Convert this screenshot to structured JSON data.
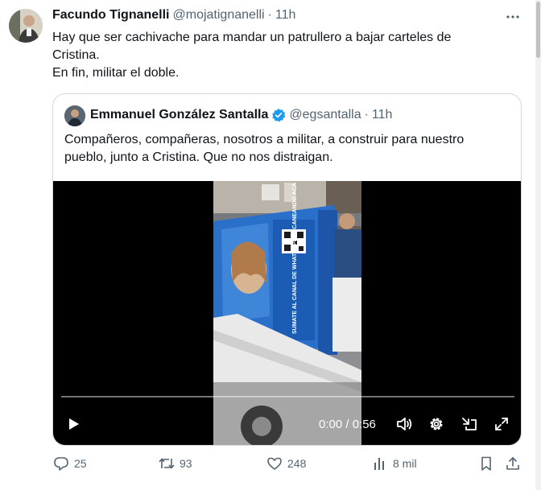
{
  "tweet": {
    "author_name": "Facundo Tignanelli",
    "handle": "@mojatignanelli",
    "separator": "·",
    "time": "11h",
    "text_lines": [
      "Hay que ser cachivache para mandar un patrullero a bajar carteles de",
      "Cristina.",
      "En fin, militar el doble."
    ]
  },
  "quote": {
    "author_name": "Emmanuel González Santalla",
    "handle": "@egsantalla",
    "separator": "·",
    "time": "11h",
    "text_lines": [
      "Compañeros, compañeras, nosotros a militar, a construir para nuestro",
      "pueblo, junto a Cristina. Que no nos distraigan."
    ],
    "video": {
      "time_display": "0:00 / 0:56",
      "progress": 0,
      "sign_text": "SUMATE AL CANAL DE WHATSAPP ESCANEANDO ACÁ"
    }
  },
  "actions": {
    "replies": "25",
    "retweets": "93",
    "likes": "248",
    "views": "8 mil"
  },
  "colors": {
    "text": "#0f1419",
    "secondary": "#536471",
    "border": "#cfd9de",
    "verified": "#1d9bf0"
  }
}
